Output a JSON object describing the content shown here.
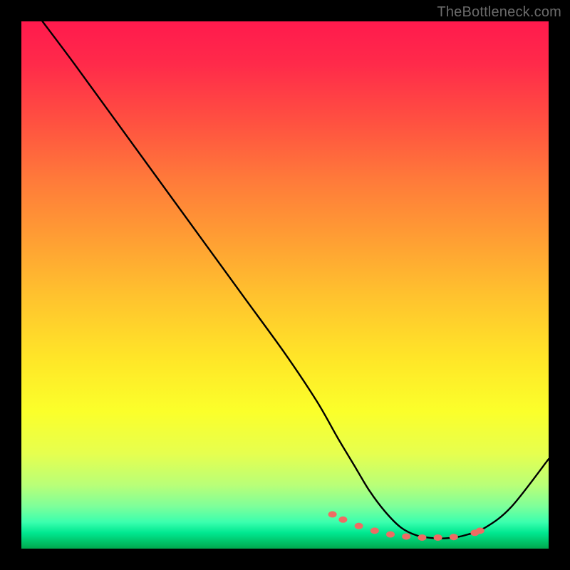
{
  "watermark": "TheBottleneck.com",
  "chart_data": {
    "type": "line",
    "title": "",
    "xlabel": "",
    "ylabel": "",
    "xlim": [
      0,
      100
    ],
    "ylim": [
      0,
      100
    ],
    "series": [
      {
        "name": "bottleneck-curve",
        "x": [
          4,
          10,
          18,
          26,
          34,
          42,
          50,
          56,
          60,
          63,
          66,
          69,
          72,
          75,
          78,
          81,
          84,
          88,
          93,
          100
        ],
        "y": [
          100,
          92,
          81,
          70,
          59,
          48,
          37,
          28,
          21,
          16,
          11,
          7,
          4,
          2.5,
          2,
          2,
          2.5,
          4,
          8,
          17
        ]
      }
    ],
    "markers": {
      "name": "highlight-dots",
      "x": [
        59,
        61,
        64,
        67,
        70,
        73,
        76,
        79,
        82,
        86,
        87
      ],
      "y": [
        6.5,
        5.5,
        4.3,
        3.4,
        2.7,
        2.3,
        2.1,
        2.1,
        2.2,
        3.0,
        3.4
      ],
      "color": "#ef6b63",
      "rx": 6,
      "ry": 4.5
    }
  }
}
